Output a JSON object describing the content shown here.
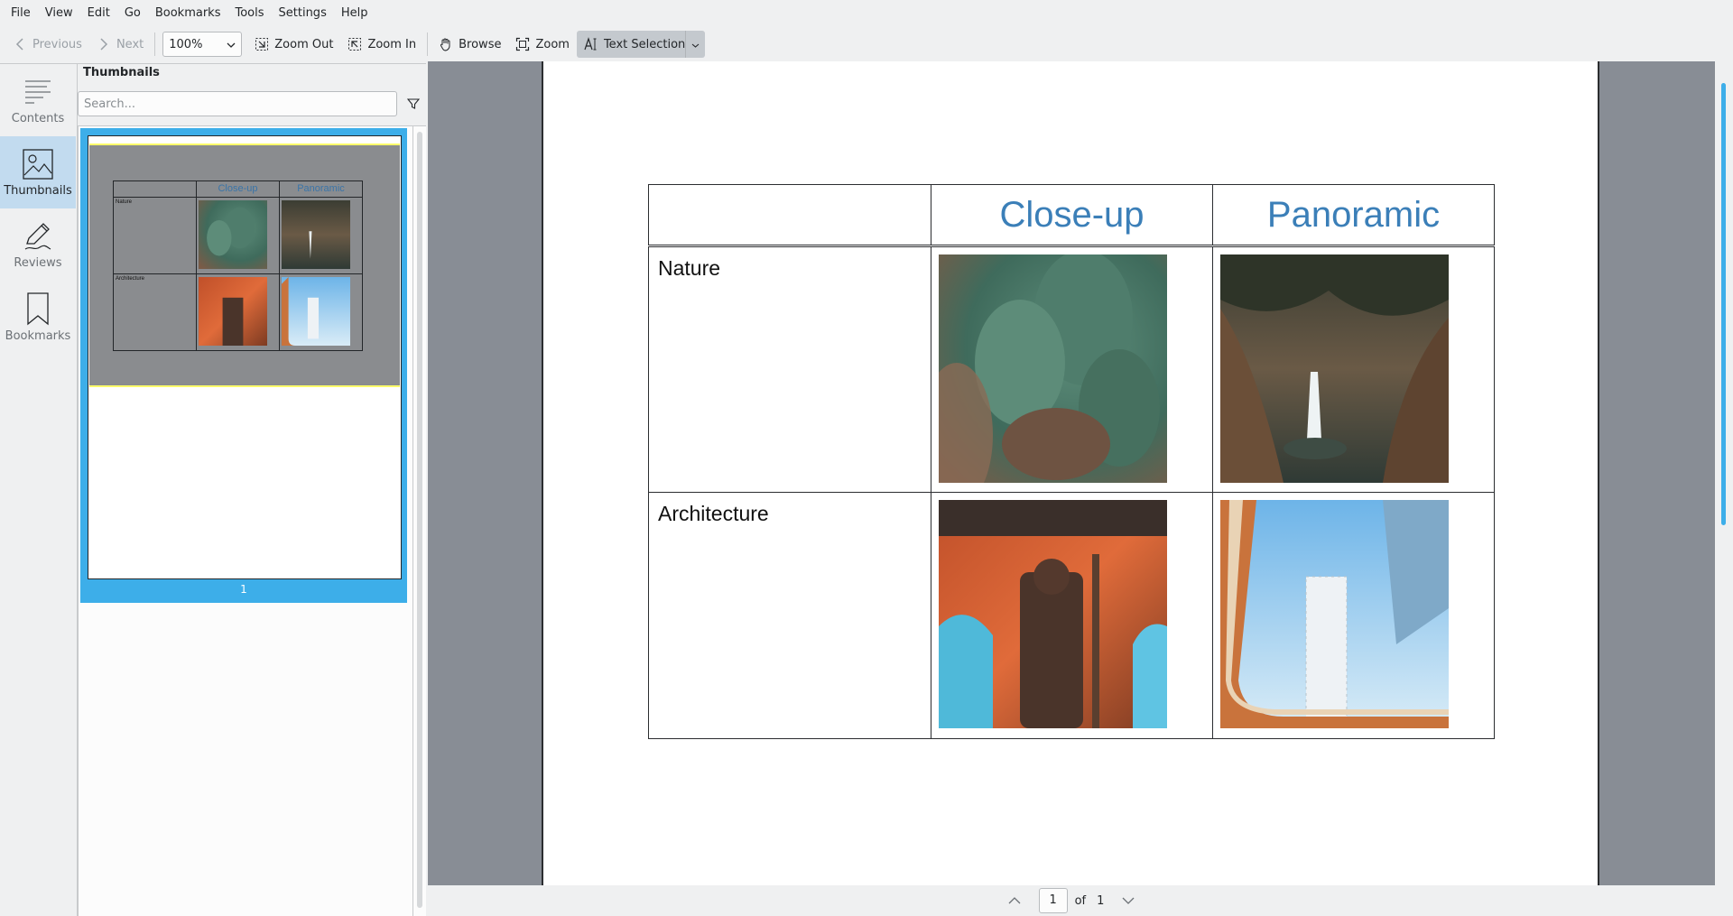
{
  "menubar": {
    "items": [
      "File",
      "View",
      "Edit",
      "Go",
      "Bookmarks",
      "Tools",
      "Settings",
      "Help"
    ]
  },
  "toolbar": {
    "previous_label": "Previous",
    "next_label": "Next",
    "zoom_value": "100%",
    "zoom_out_label": "Zoom Out",
    "zoom_in_label": "Zoom In",
    "browse_label": "Browse",
    "zoom_label": "Zoom",
    "text_selection_label": "Text Selection"
  },
  "sidebar": {
    "tabs": [
      {
        "label": "Contents",
        "icon": "contents-icon",
        "active": false
      },
      {
        "label": "Thumbnails",
        "icon": "image-icon",
        "active": true
      },
      {
        "label": "Reviews",
        "icon": "pen-icon",
        "active": false
      },
      {
        "label": "Bookmarks",
        "icon": "bookmark-icon",
        "active": false
      }
    ]
  },
  "thumbnails": {
    "title": "Thumbnails",
    "search_placeholder": "Search...",
    "page_number": "1"
  },
  "document": {
    "table": {
      "headers": [
        "",
        "Close-up",
        "Panoramic"
      ],
      "rows": [
        {
          "label": "Nature",
          "images": [
            "cactus-closeup-photo",
            "waterfall-panoramic-photo"
          ]
        },
        {
          "label": "Architecture",
          "images": [
            "statue-closeup-photo",
            "tower-panoramic-photo"
          ]
        }
      ]
    }
  },
  "page_nav": {
    "current": "1",
    "of_label": "of",
    "total": "1"
  },
  "colors": {
    "accent": "#3daee9",
    "header_text": "#3b7fb8",
    "doc_background": "#888d95"
  }
}
